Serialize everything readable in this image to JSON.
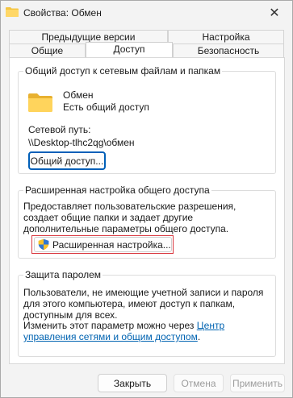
{
  "window": {
    "title": "Свойства: Обмен",
    "close_label": "✕"
  },
  "tabs": {
    "row1": [
      "Предыдущие версии",
      "Настройка"
    ],
    "row2": [
      "Общие",
      "Доступ",
      "Безопасность"
    ]
  },
  "share_group": {
    "title": "Общий доступ к сетевым файлам и папкам",
    "folder_name": "Обмен",
    "folder_status": "Есть общий доступ",
    "path_label": "Сетевой путь:",
    "path_value": "\\\\Desktop-tlhc2qg\\обмен",
    "share_button": "Общий доступ..."
  },
  "advanced_group": {
    "title": "Расширенная настройка общего доступа",
    "description": "Предоставляет пользовательские разрешения, создает общие папки и задает другие дополнительные параметры общего доступа.",
    "button": "Расширенная настройка..."
  },
  "password_group": {
    "title": "Защита паролем",
    "description": "Пользователи, не имеющие учетной записи и пароля для этого компьютера, имеют доступ к папкам, доступным для всех.",
    "change_text": "Изменить этот параметр можно через ",
    "link_text": "Центр управления сетями и общим доступом",
    "end_text": "."
  },
  "footer": {
    "close": "Закрыть",
    "cancel": "Отмена",
    "apply": "Применить"
  },
  "colors": {
    "accent": "#005fb8",
    "link": "#0063b1",
    "highlight": "#d9363e",
    "folder": "#f4c542"
  }
}
